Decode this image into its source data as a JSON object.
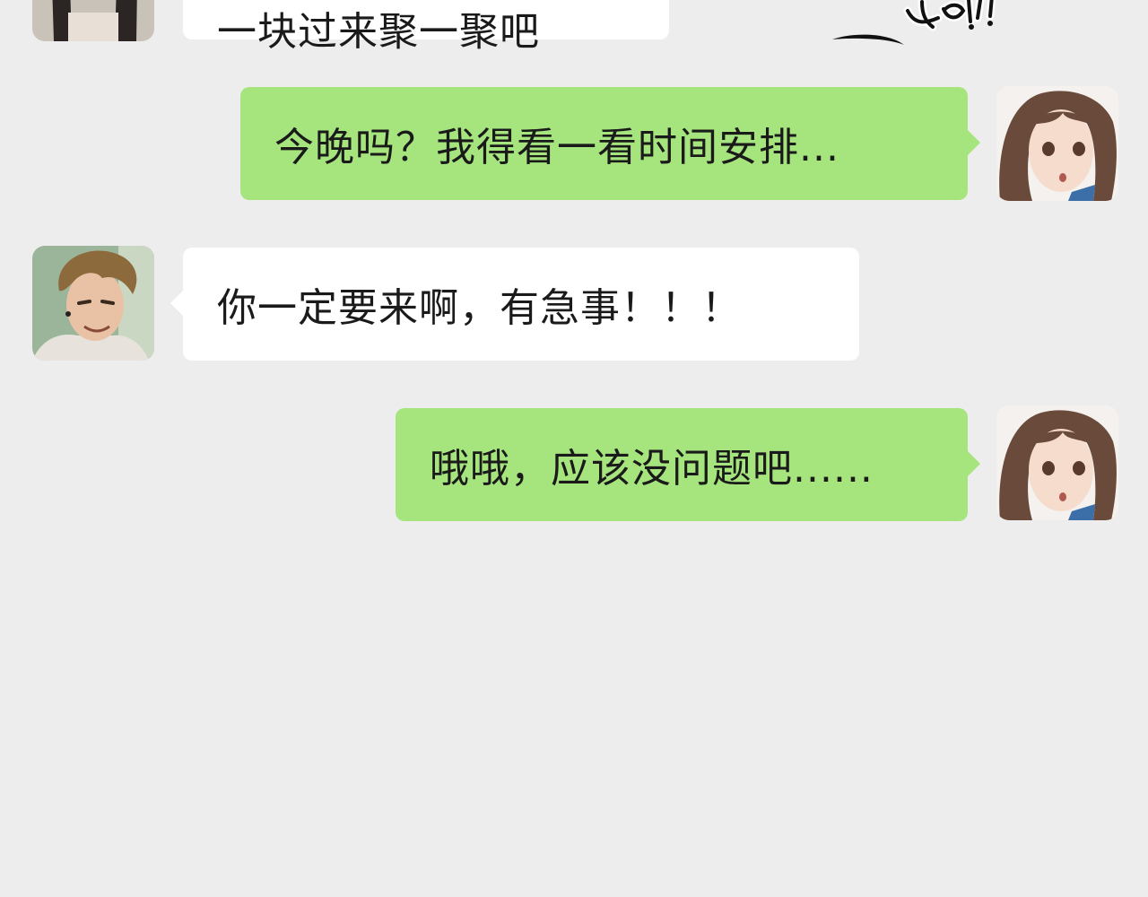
{
  "chat": {
    "messages": [
      {
        "sender": "male-friend",
        "side": "left",
        "text": "一块过来聚一聚吧"
      },
      {
        "sender": "female-self",
        "side": "right",
        "text": "今晚吗？我得看一看时间安排..."
      },
      {
        "sender": "male-friend",
        "side": "left",
        "text": "你一定要来啊，有急事！！！"
      },
      {
        "sender": "female-self",
        "side": "right",
        "text": "哦哦，应该没问题吧......"
      }
    ]
  },
  "sound_effect": {
    "text": "Ya!!"
  },
  "colors": {
    "background": "#ededed",
    "received_bubble": "#ffffff",
    "sent_bubble": "#a6e57e",
    "text": "#1a1a1a"
  }
}
